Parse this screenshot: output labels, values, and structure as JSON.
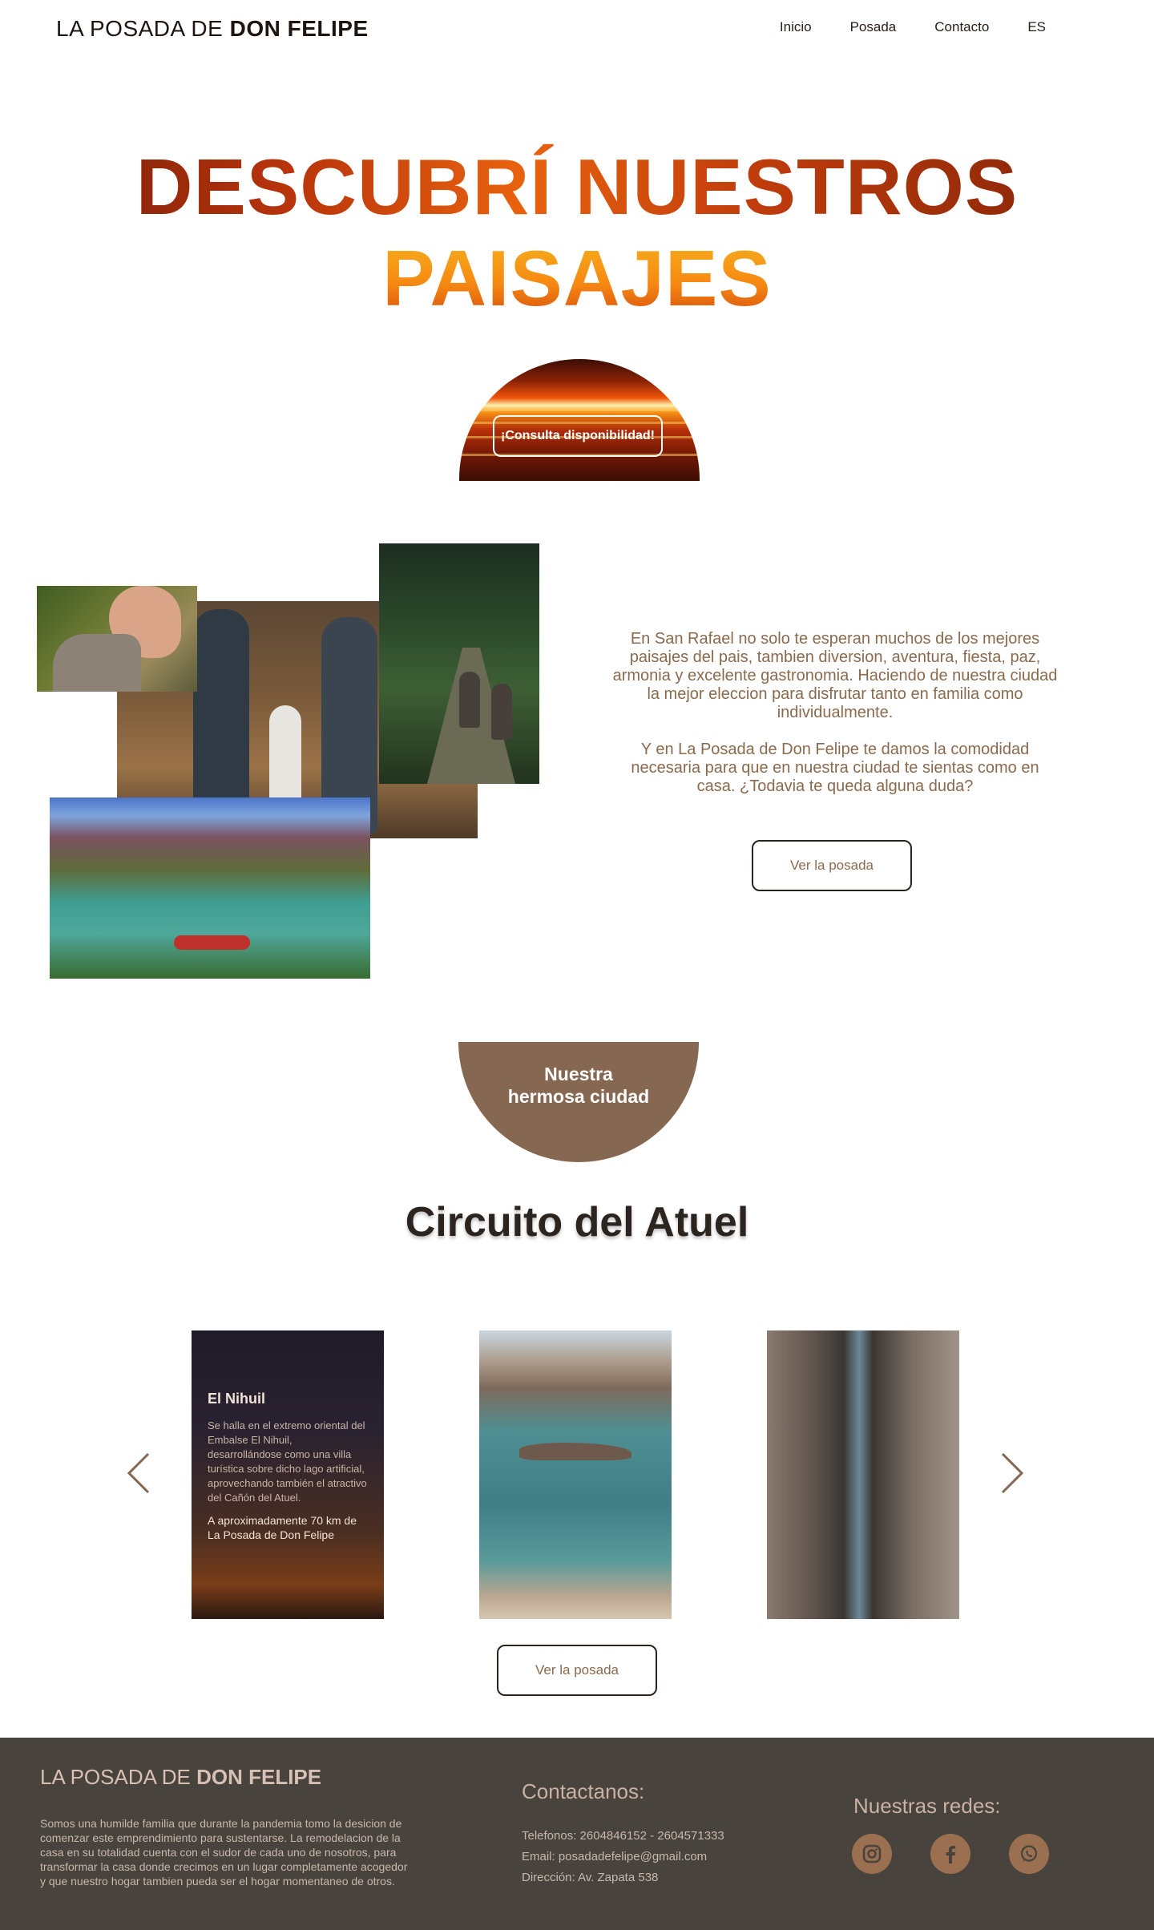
{
  "header": {
    "logo_prefix": "LA POSADA DE ",
    "logo_bold": "DON FELIPE",
    "nav": [
      "Inicio",
      "Posada",
      "Contacto",
      "ES"
    ]
  },
  "hero": {
    "line1": "DESCUBRÍ NUESTROS",
    "line2": "PAISAJES",
    "cta_label": "¡Consulta disponibilidad!"
  },
  "intro": {
    "paragraph1": "En San Rafael no solo te esperan muchos de los mejores paisajes del pais, tambien diversion, aventura, fiesta, paz, armonia y excelente gastronomia. Haciendo de nuestra ciudad la mejor eleccion para disfrutar tanto en familia como individualmente.",
    "paragraph2": "Y en La Posada de Don Felipe te damos la comodidad necesaria para que en nuestra ciudad te sientas como en casa. ¿Todavia te queda alguna duda?",
    "button_label": "Ver la posada"
  },
  "city_badge": {
    "line1": "Nuestra",
    "line2": "hermosa ciudad"
  },
  "circuit": {
    "title_light": "Circuito del ",
    "title_bold": "Atuel",
    "cards": [
      {
        "title": "El Nihuil",
        "description": "Se halla en el extremo oriental del Embalse El Nihuil, desarrollándose como una villa turística sobre dicho lago artificial, aprovechando también el atractivo del Cañón del Atuel.",
        "distance": "A aproximadamente 70 km de La Posada de Don Felipe"
      }
    ],
    "button_label": "Ver la posada"
  },
  "footer": {
    "logo_prefix": "LA POSADA DE ",
    "logo_bold": "DON FELIPE",
    "about": "Somos una humilde familia que durante la pandemia tomo la desicion de comenzar este emprendimiento para sustentarse. La remodelacion de la casa en su totalidad cuenta con el sudor de cada uno de nosotros, para transformar la casa donde crecimos en un lugar completamente acogedor y que nuestro hogar tambien pueda ser el hogar momentaneo de otros.",
    "contact_title": "Contactanos:",
    "phone": "Telefonos: 2604846152 - 2604571333",
    "email": "Email: posadadefelipe@gmail.com",
    "address": "Dirección: Av. Zapata 538",
    "social_title": "Nuestras redes:",
    "social_icons": [
      "instagram-icon",
      "facebook-icon",
      "whatsapp-icon"
    ]
  },
  "colors": {
    "accent_brown": "#866852",
    "text_brown": "#8a6a4d",
    "footer_bg": "#49433d",
    "social_bg": "#9a7050"
  }
}
